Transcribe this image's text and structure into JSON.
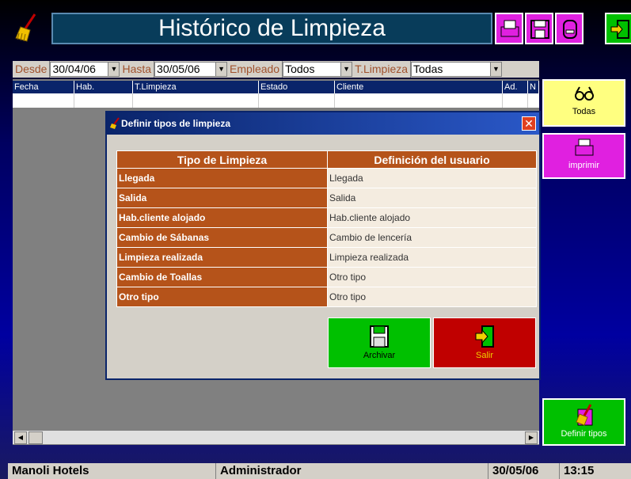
{
  "app": {
    "title": "Histórico de Limpieza"
  },
  "filters": {
    "desde_label": "Desde",
    "desde_value": "30/04/06",
    "hasta_label": "Hasta",
    "hasta_value": "30/05/06",
    "empleado_label": "Empleado",
    "empleado_value": "Todos",
    "tlimpieza_label": "T.Limpieza",
    "tlimpieza_value": "Todas"
  },
  "grid": {
    "columns": [
      "Fecha",
      "Hab.",
      "T.Limpieza",
      "Estado",
      "Cliente",
      "Ad.",
      "N"
    ]
  },
  "sidebar": {
    "todas_label": "Todas",
    "imprimir_label": "imprimir",
    "definir_label": "Definir tipos"
  },
  "dialog": {
    "title": "Definir tipos de limpieza",
    "col_tipo": "Tipo de Limpieza",
    "col_def": "Definición del usuario",
    "rows": [
      {
        "tipo": "Llegada",
        "def": "Llegada"
      },
      {
        "tipo": "Salida",
        "def": "Salida"
      },
      {
        "tipo": "Hab.cliente alojado",
        "def": "Hab.cliente alojado"
      },
      {
        "tipo": "Cambio de Sábanas",
        "def": "Cambio de lencería"
      },
      {
        "tipo": "Limpieza realizada",
        "def": "Limpieza realizada"
      },
      {
        "tipo": "Cambio de Toallas",
        "def": "Otro tipo"
      },
      {
        "tipo": "Otro tipo",
        "def": "Otro tipo"
      }
    ],
    "archivar_label": "Archivar",
    "salir_label": "Salir"
  },
  "status": {
    "company": "Manoli Hotels",
    "user": "Administrador",
    "date": "30/05/06",
    "time": "13:15"
  },
  "colors": {
    "accent_brown": "#b5531a",
    "btn_green": "#00c000",
    "btn_red": "#c00000",
    "btn_yellow": "#ffff80",
    "btn_magenta": "#e020e0"
  }
}
